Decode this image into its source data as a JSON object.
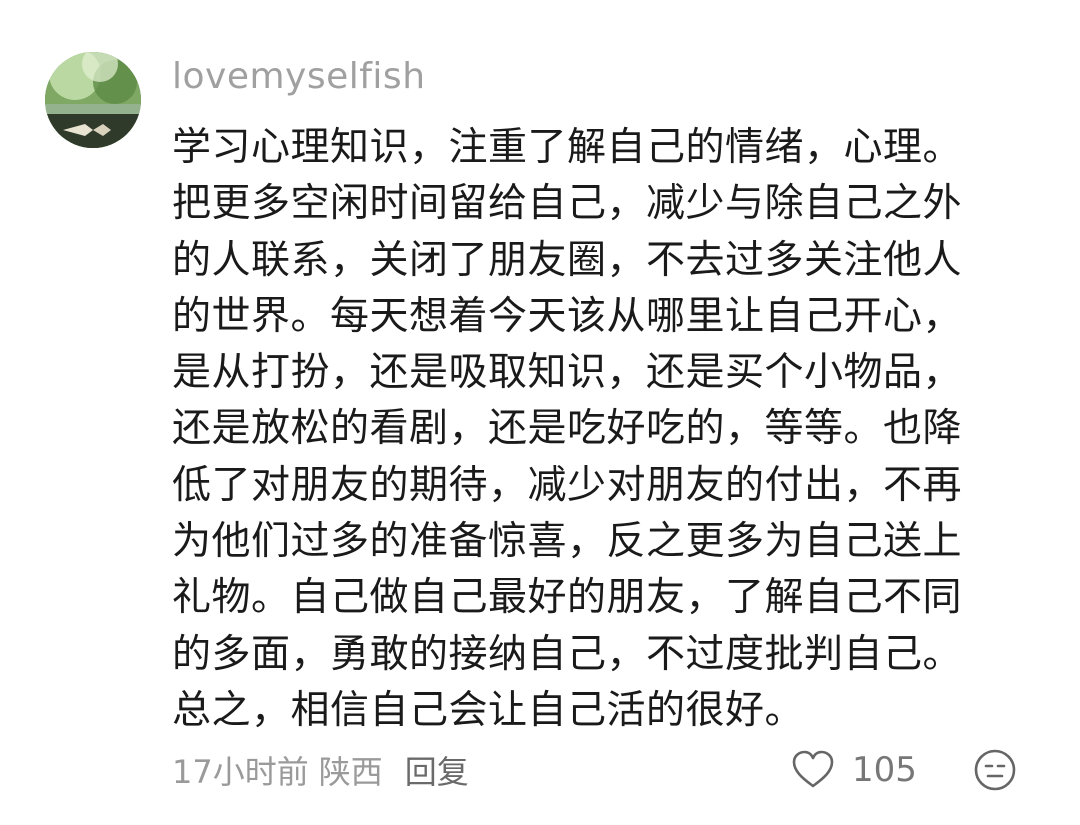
{
  "comment": {
    "username": "lovemyselfish",
    "avatar_icon": "avatar-photo",
    "body_lines": [
      "学习心理知识，注重了解自己的情绪，心理。",
      "把更多空闲时间留给自己，减少与除自己之外",
      "的人联系，关闭了朋友圈，不去过多关注他人",
      "的世界。每天想着今天该从哪里让自己开心，",
      "是从打扮，还是吸取知识，还是买个小物品，",
      "还是放松的看剧，还是吃好吃的，等等。也降",
      "低了对朋友的期待，减少对朋友的付出，不再",
      "为他们过多的准备惊喜，反之更多为自己送上",
      "礼物。自己做自己最好的朋友，了解自己不同",
      "的多面，勇敢的接纳自己，不过度批判自己。",
      "总之，相信自己会让自己活的很好。"
    ],
    "time": "17小时前",
    "region": "陕西",
    "reply_label": "回复",
    "like_icon": "heart-icon",
    "like_count": "105",
    "emoji_icon": "emoji-icon"
  },
  "colors": {
    "username": "#a0a0a0",
    "body": "#1a1a1a",
    "meta": "#9a9a9a"
  }
}
